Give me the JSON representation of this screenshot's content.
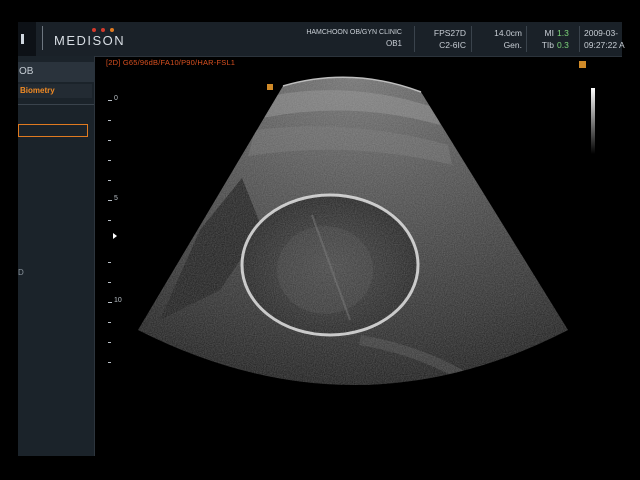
{
  "header": {
    "logo": "MEDISON",
    "logo_dot_colors": [
      "#d33a2c",
      "#d33a2c",
      "#e07a20"
    ],
    "clinic": "HAMCHOON OB/GYN CLINIC",
    "operator": "OB1",
    "probe_frame": "FPS27D",
    "probe_id": "C2-6IC",
    "depth": "14.0cm",
    "preset": "Gen.",
    "mi_label": "MI",
    "mi_value": "1.3",
    "tib_label": "TIb",
    "tib_value": "0.3",
    "date": "2009-03-",
    "time": "09:27:22 A"
  },
  "left_panel": {
    "title": "OB",
    "subtitle": "Biometry",
    "glyph": "D"
  },
  "image": {
    "mode_line": "[2D] G65/96dB/FA10/P90/HAR-FSL1",
    "scale_labels": [
      "0",
      "5",
      "10"
    ],
    "colors": {
      "accent_orange": "#e07a20",
      "mode_text": "#d85020",
      "value_green": "#7dd67a"
    }
  }
}
